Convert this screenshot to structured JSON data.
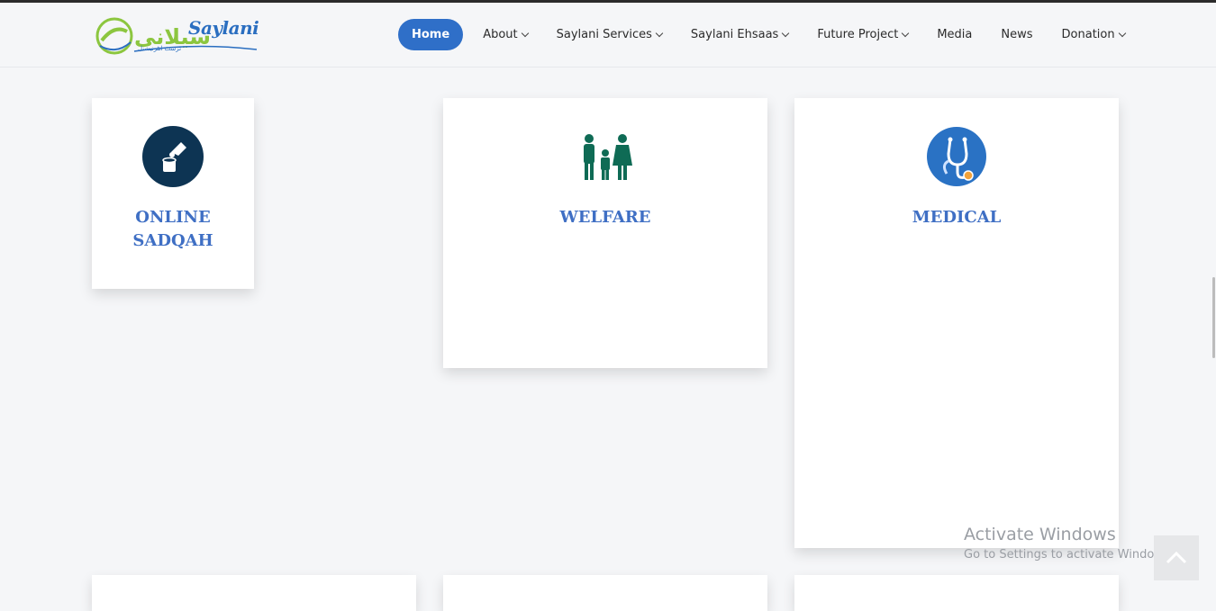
{
  "header": {
    "logo_text": "Saylani",
    "logo_urdu": "سیلانی",
    "logo_sub": "ٹرسٹ انٹرنیشنل"
  },
  "nav": {
    "items": [
      {
        "label": "Home",
        "active": true,
        "dropdown": false
      },
      {
        "label": "About",
        "active": false,
        "dropdown": true
      },
      {
        "label": "Saylani Services",
        "active": false,
        "dropdown": true
      },
      {
        "label": "Saylani Ehsaas",
        "active": false,
        "dropdown": true
      },
      {
        "label": "Future Project",
        "active": false,
        "dropdown": true
      },
      {
        "label": "Media",
        "active": false,
        "dropdown": false
      },
      {
        "label": "News",
        "active": false,
        "dropdown": false
      },
      {
        "label": "Donation",
        "active": false,
        "dropdown": true
      }
    ]
  },
  "cards": {
    "online_sadqah": {
      "title": "ONLINE SADQAH",
      "icon": "donation-box-icon"
    },
    "welfare": {
      "title": "WELFARE",
      "icon": "family-icon"
    },
    "medical": {
      "title": "MEDICAL",
      "icon": "stethoscope-icon"
    }
  },
  "watermark": {
    "line1": "Activate Windows",
    "line2": "Go to Settings to activate Windows."
  },
  "colors": {
    "accent": "#2f6fc8",
    "title": "#3f6fc4",
    "welfare_green": "#0f6b55",
    "sadqah_navy": "#0d3453",
    "medical_blue": "#2a72c4"
  }
}
